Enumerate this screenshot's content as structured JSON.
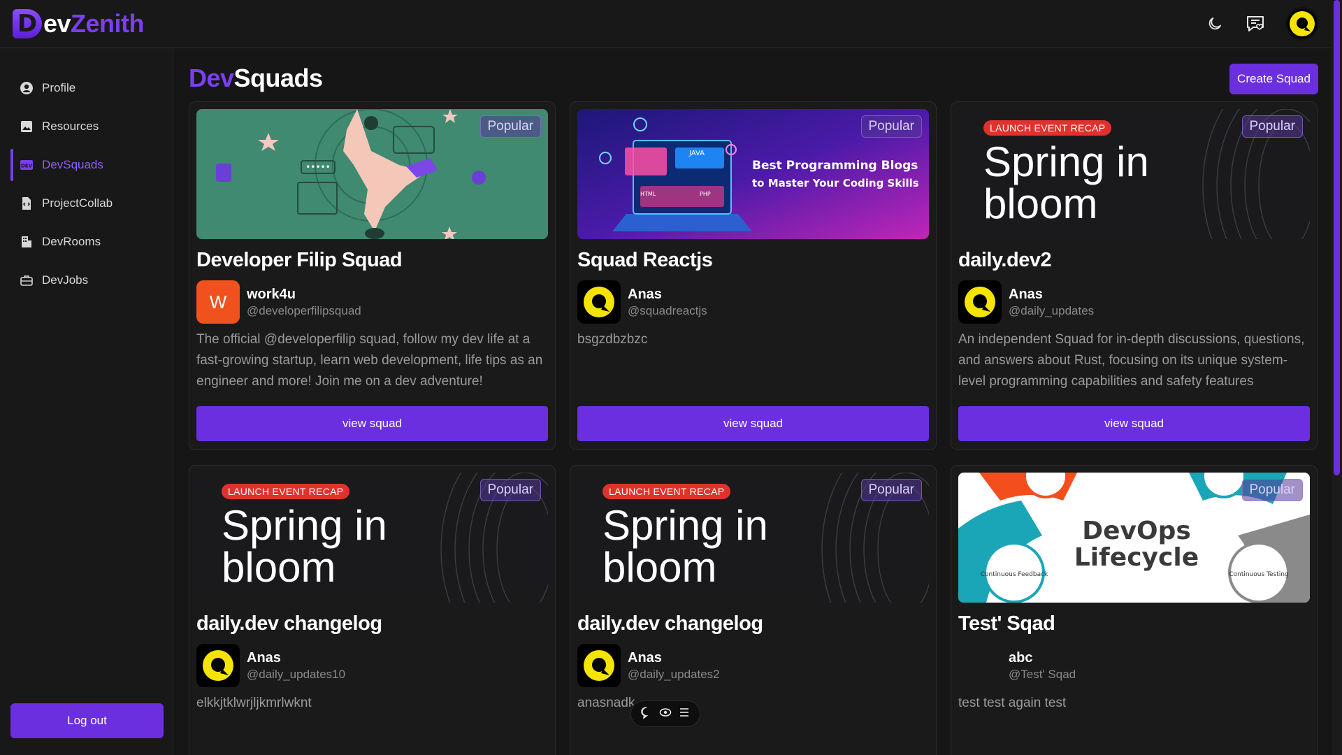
{
  "app": {
    "logo_letter": "D",
    "logo_text_a": "ev",
    "logo_text_b": "Zenith"
  },
  "sidebar": {
    "items": [
      {
        "label": "Profile",
        "icon": "user-circle-icon"
      },
      {
        "label": "Resources",
        "icon": "image-icon"
      },
      {
        "label": "DevSquads",
        "icon": "dev-badge-icon",
        "active": true
      },
      {
        "label": "ProjectCollab",
        "icon": "code-file-icon"
      },
      {
        "label": "DevRooms",
        "icon": "building-icon"
      },
      {
        "label": "DevJobs",
        "icon": "briefcase-icon"
      }
    ],
    "logout_label": "Log out"
  },
  "page": {
    "title_a": "Dev",
    "title_b": "Squads",
    "create_label": "Create Squad"
  },
  "badges": {
    "popular": "Popular",
    "launch": "LAUNCH EVENT RECAP",
    "view": "view squad"
  },
  "cards": [
    {
      "title": "Developer Filip Squad",
      "owner": "work4u",
      "handle": "@developerfilipsquad",
      "avatar_letter": "W",
      "desc": "The official @developerfilip squad, follow my dev life at a fast-growing startup, learn web development, life tips as an engineer and more! Join me on a dev adventure!"
    },
    {
      "title": "Squad Reactjs",
      "owner": "Anas",
      "handle": "@squadreactjs",
      "desc": "bsgzdbzbzc",
      "banner_line1": "Best Programming Blogs",
      "banner_line2": "to Master Your Coding Skills",
      "banner_tag_java": "JAVA",
      "banner_tag_php": "PHP",
      "banner_tag_html": "HTML"
    },
    {
      "title": "daily.dev2",
      "owner": "Anas",
      "handle": "@daily_updates",
      "desc": "An independent Squad for in-depth discussions, questions, and answers about Rust, focusing on its unique system-level programming capabilities and safety features",
      "spring_1": "Spring in",
      "spring_2": "bloom"
    },
    {
      "title": "daily.dev changelog",
      "owner": "Anas",
      "handle": "@daily_updates10",
      "desc": "elkkjtklwrjljkmrlwknt",
      "spring_1": "Spring in",
      "spring_2": "bloom"
    },
    {
      "title": "daily.dev changelog",
      "owner": "Anas",
      "handle": "@daily_updates2",
      "desc": "anasnadk",
      "spring_1": "Spring in",
      "spring_2": "bloom"
    },
    {
      "title": "Test' Sqad",
      "owner": "abc",
      "handle": "@Test' Sqad",
      "desc": "test test again test",
      "devops_1": "DevOps",
      "devops_2": "Lifecycle",
      "devops_left": "Continuous Feedback",
      "devops_right": "Continuous Testing"
    }
  ],
  "colors": {
    "accent": "#6b2fe0",
    "logo_yellow": "#f5e400",
    "launch_red": "#e0322c"
  }
}
